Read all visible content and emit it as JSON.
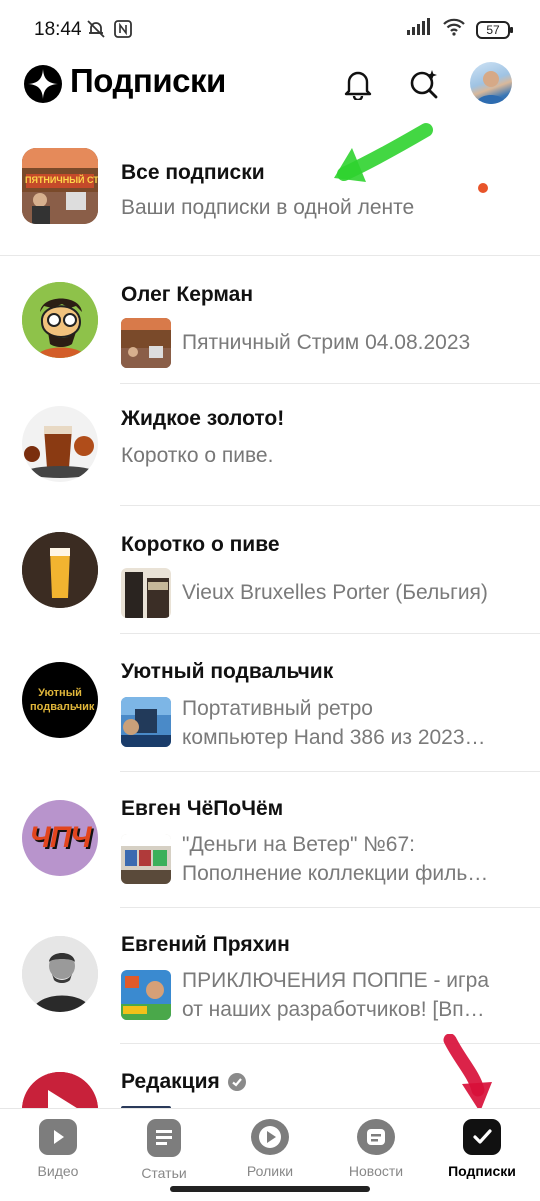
{
  "status_bar": {
    "time": "18:44",
    "battery": "57"
  },
  "header": {
    "title": "Подписки"
  },
  "all_subscriptions": {
    "name": "Все подписки",
    "subtitle": "Ваши подписки в одной ленте",
    "thumb_text": "ПЯТНИЧНЫЙ СТ"
  },
  "channels": [
    {
      "name": "Олег Керман",
      "post_lines": [
        "Пятничный Стрим 04.08.2023"
      ]
    },
    {
      "name": "Жидкое золото!",
      "subtitle": "Коротко о пиве."
    },
    {
      "name": "Коротко о пиве",
      "post_lines": [
        "Vieux Bruxelles Porter (Бельгия)"
      ]
    },
    {
      "name": "Уютный подвальчик",
      "avatar_text": "Уютный подвальчик",
      "post_lines": [
        "Портативный ретро",
        "компьютер Hand 386 из 2023…"
      ]
    },
    {
      "name": "Евген ЧёПоЧём",
      "avatar_text": "ЧПЧ",
      "post_lines": [
        "\"Деньги на Ветер\" №67:",
        "Пополнение коллекции филь…"
      ]
    },
    {
      "name": "Евгений Пряхин",
      "post_lines": [
        "ПРИКЛЮЧЕНИЯ ПОППЕ - игра",
        "от наших разработчиков! [Вп…"
      ]
    },
    {
      "name": "Редакция"
    }
  ],
  "bottom_nav": [
    {
      "label": "Видео",
      "icon": "video-icon"
    },
    {
      "label": "Статьи",
      "icon": "articles-icon"
    },
    {
      "label": "Ролики",
      "icon": "shorts-icon"
    },
    {
      "label": "Новости",
      "icon": "news-icon"
    },
    {
      "label": "Подписки",
      "icon": "subscriptions-icon",
      "active": true
    }
  ],
  "colors": {
    "accent_dot": "#e8542a",
    "arrow_green": "#2fd32f",
    "arrow_red": "#d8103a"
  }
}
